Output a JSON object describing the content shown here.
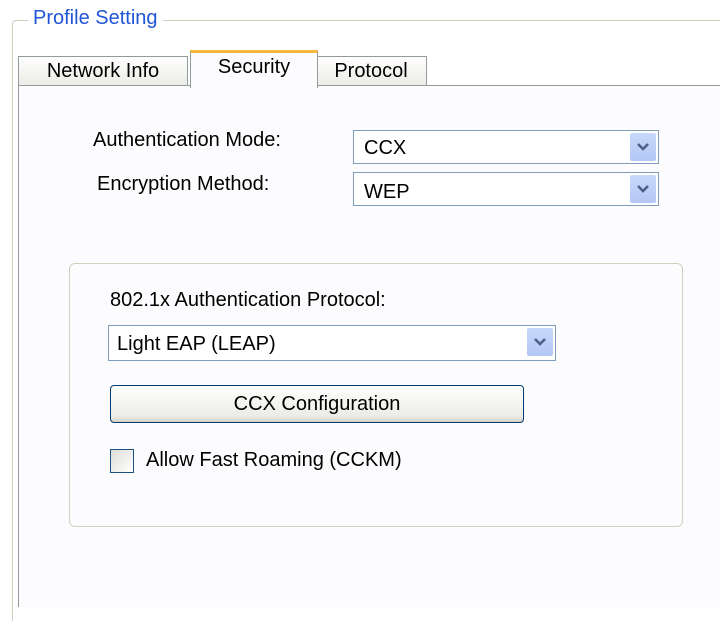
{
  "group": {
    "title": "Profile Setting"
  },
  "tabs": [
    {
      "label": "Network Info"
    },
    {
      "label": "Security"
    },
    {
      "label": "Protocol"
    }
  ],
  "auth_mode": {
    "label": "Authentication Mode:",
    "value": "CCX"
  },
  "encryption": {
    "label": "Encryption Method:",
    "value": "WEP"
  },
  "eap": {
    "label": "802.1x Authentication Protocol:",
    "value": "Light EAP (LEAP)",
    "config_button": "CCX Configuration",
    "fast_roaming_label": "Allow Fast Roaming (CCKM)"
  },
  "icons": {
    "dropdown": "chevron-down-icon",
    "checkbox": "checkbox-unchecked"
  },
  "colors": {
    "title": "#1f55d6",
    "active_tab_accent": "#f5b73c",
    "arrow_bg": "#c0d3f8",
    "arrow_glyph": "#4d6185"
  }
}
